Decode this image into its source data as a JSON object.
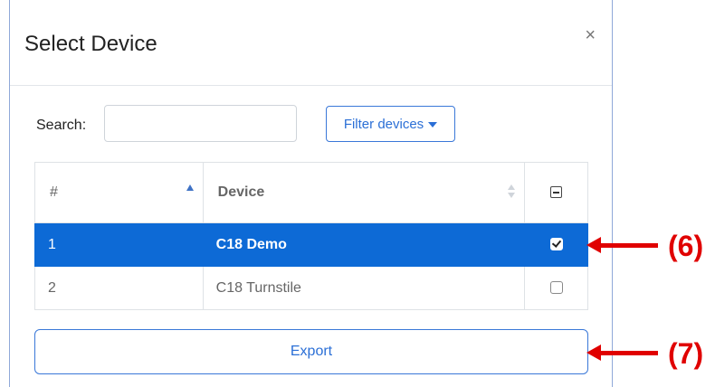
{
  "modal": {
    "title": "Select Device",
    "close_glyph": "×"
  },
  "search": {
    "label": "Search:",
    "value": "",
    "placeholder": ""
  },
  "filter": {
    "label": "Filter devices"
  },
  "table": {
    "columns": [
      {
        "label": "#",
        "sort": "ascending"
      },
      {
        "label": "Device",
        "sort": "none"
      },
      {
        "label": "",
        "header_checkbox": "indeterminate"
      }
    ],
    "rows": [
      {
        "num": "1",
        "device": "C18 Demo",
        "checked": true,
        "selected": true
      },
      {
        "num": "2",
        "device": "C18 Turnstile",
        "checked": false,
        "selected": false
      }
    ]
  },
  "export": {
    "label": "Export"
  },
  "annotations": [
    {
      "label": "(6)",
      "color": "#e00000"
    },
    {
      "label": "(7)",
      "color": "#e00000"
    }
  ],
  "colors": {
    "selected_row": "#0d6ad6",
    "accent": "#2b6fd6",
    "annotation": "#e00000"
  }
}
